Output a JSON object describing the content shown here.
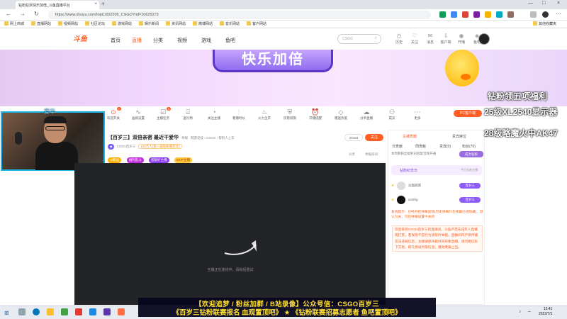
{
  "browser": {
    "tab_title": "钻粉狂欢快乐加倍_斗鱼直播平台",
    "url": "https://www.douyu.com/topic/202205_CSGO?rid=10625373",
    "bookmarks": [
      "网上商城",
      "直播网站",
      "视频网站",
      "社区论坛",
      "游戏网站",
      "娱乐新闻",
      "资讯网站",
      "微博网站",
      "音乐网站",
      "客户网站"
    ],
    "bookmark_right": "其他收藏夹"
  },
  "site": {
    "logo": "斗鱼",
    "nav": [
      "首页",
      "直播",
      "分类",
      "视频",
      "游戏",
      "鱼吧"
    ],
    "search_placeholder": "CSGO",
    "header_icons": [
      "历史",
      "关注",
      "消息",
      "客户端",
      "开播",
      "鱼吧"
    ]
  },
  "banner": {
    "title": "快乐加倍"
  },
  "promo": {
    "line1": "钻粉领五项福利",
    "line2": "25级XL2540显示器",
    "line3": "28级略魔火中AK47"
  },
  "webcam": {
    "label": "爱华"
  },
  "toolbar": {
    "items": [
      "欢迎开关",
      "画质设置",
      "主播任务",
      "送礼物",
      "关注主播",
      "看播时长",
      "火力全开",
      "房管权限",
      "开播提醒",
      "赠送热度",
      "分享直播",
      "成员",
      "更多"
    ],
    "badge1": "1",
    "badge2": "2",
    "pc_button": "PC客户端"
  },
  "room": {
    "title": "【百岁三】双倍亲密 最近干爱华",
    "category": "举报",
    "tags_text": "网游竞技 › CSGO › 帮别人上车",
    "id_label": "CSGO百岁三",
    "meta": "100万人(第一届钻粉嘉年华)",
    "pill1": "V/粉丝",
    "pill2": "福利乱斗",
    "pill3": "超级好主播",
    "pill4": "MVP主播",
    "fans_count": "20193",
    "follow_label": "关注",
    "share": "分享",
    "report": "举报房间"
  },
  "video": {
    "loading_text": "主播正在连线中，请稍后重试"
  },
  "rpanel": {
    "tabs": [
      "主播贡献",
      "贵宾席位"
    ],
    "tabs2": [
      "日贡献",
      "周贡献",
      "贵宾(0)",
      "粉丝(70)"
    ],
    "note": "本周和粉丝福利已回复活跃开通",
    "btn": "成为钻粉",
    "fans_day": "钻粉纪念日",
    "fans_day_sub": "今日无新主播",
    "user1": "淡烟疏雨",
    "user2": "ansthg",
    "tag": "百岁三",
    "sys_label": "系统提示：",
    "sys_text": "已经开启弹幕滤镜(历史弹幕只在弹幕已经隐藏)，默认为关，可在弹幕设置中关闭",
    "welcome": "欢迎来到CSGO百岁三的直播间。斗鱼严禁未成年人直播或打赏，若发现不良行为请及时举报。直播间内严禁传播违法违规信息，主播请保持良好的形象直播。请勿相信私下交易、刷礼物返利等信息，谨防受骗上当。"
  },
  "overlay": {
    "line1": "【欢迎追梦 / 粉丝加群 / B站录像】公众号信：CSGO百岁三",
    "line2": "《百岁三钻粉联赛报名 血观置顶吧》 ★ 《钻粉联赛招募志愿者 鱼吧置顶吧》"
  },
  "taskbar": {
    "time": "15:41",
    "date": "2022/7/1"
  },
  "colors": {
    "accent": "#ff5d23",
    "cam_border": "#1db6e8",
    "overlay_text": "#ffe033"
  }
}
